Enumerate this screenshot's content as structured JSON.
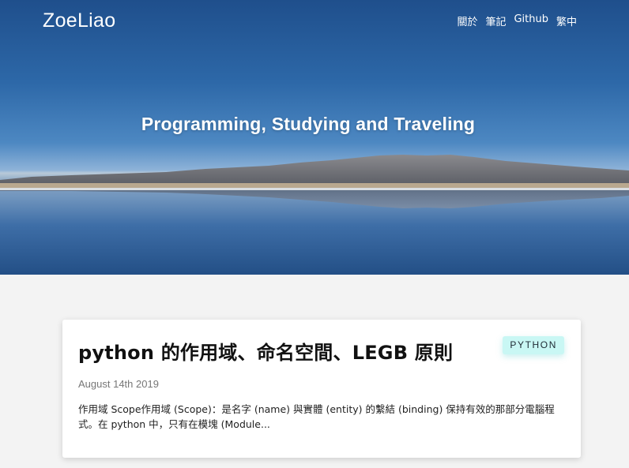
{
  "site": {
    "logo": "ZoeLiao",
    "tagline": "Programming, Studying and Traveling"
  },
  "nav": {
    "items": [
      {
        "label": "關於"
      },
      {
        "label": "筆記"
      },
      {
        "label": "Github"
      },
      {
        "label": "繁中"
      }
    ]
  },
  "post": {
    "title": "python 的作用域、命名空間、LEGB 原則",
    "tag": "PYTHON",
    "date": "August 14th 2019",
    "excerpt": "作用域 Scope作用域 (Scope)：是名字 (name) 與實體 (entity) 的繫結 (binding) 保持有效的那部分電腦程式。在 python 中，只有在模塊 (Module..."
  },
  "colors": {
    "accent_tag_bg": "#c9f7f4",
    "page_bg": "#f3f3f3"
  }
}
